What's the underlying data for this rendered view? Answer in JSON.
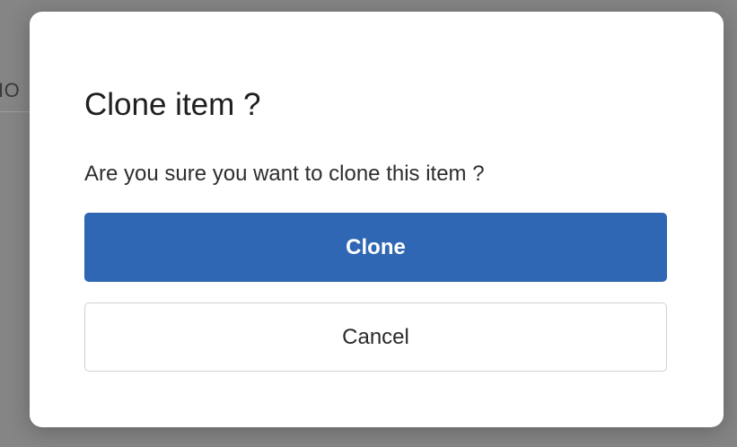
{
  "background": {
    "partial_text": "IO"
  },
  "dialog": {
    "title": "Clone item ?",
    "message": "Are you sure you want to clone this item ?",
    "confirm_label": "Clone",
    "cancel_label": "Cancel"
  },
  "colors": {
    "overlay": "#858585",
    "dialog_bg": "#ffffff",
    "primary": "#3067b4",
    "secondary_border": "#d2d2d2"
  }
}
